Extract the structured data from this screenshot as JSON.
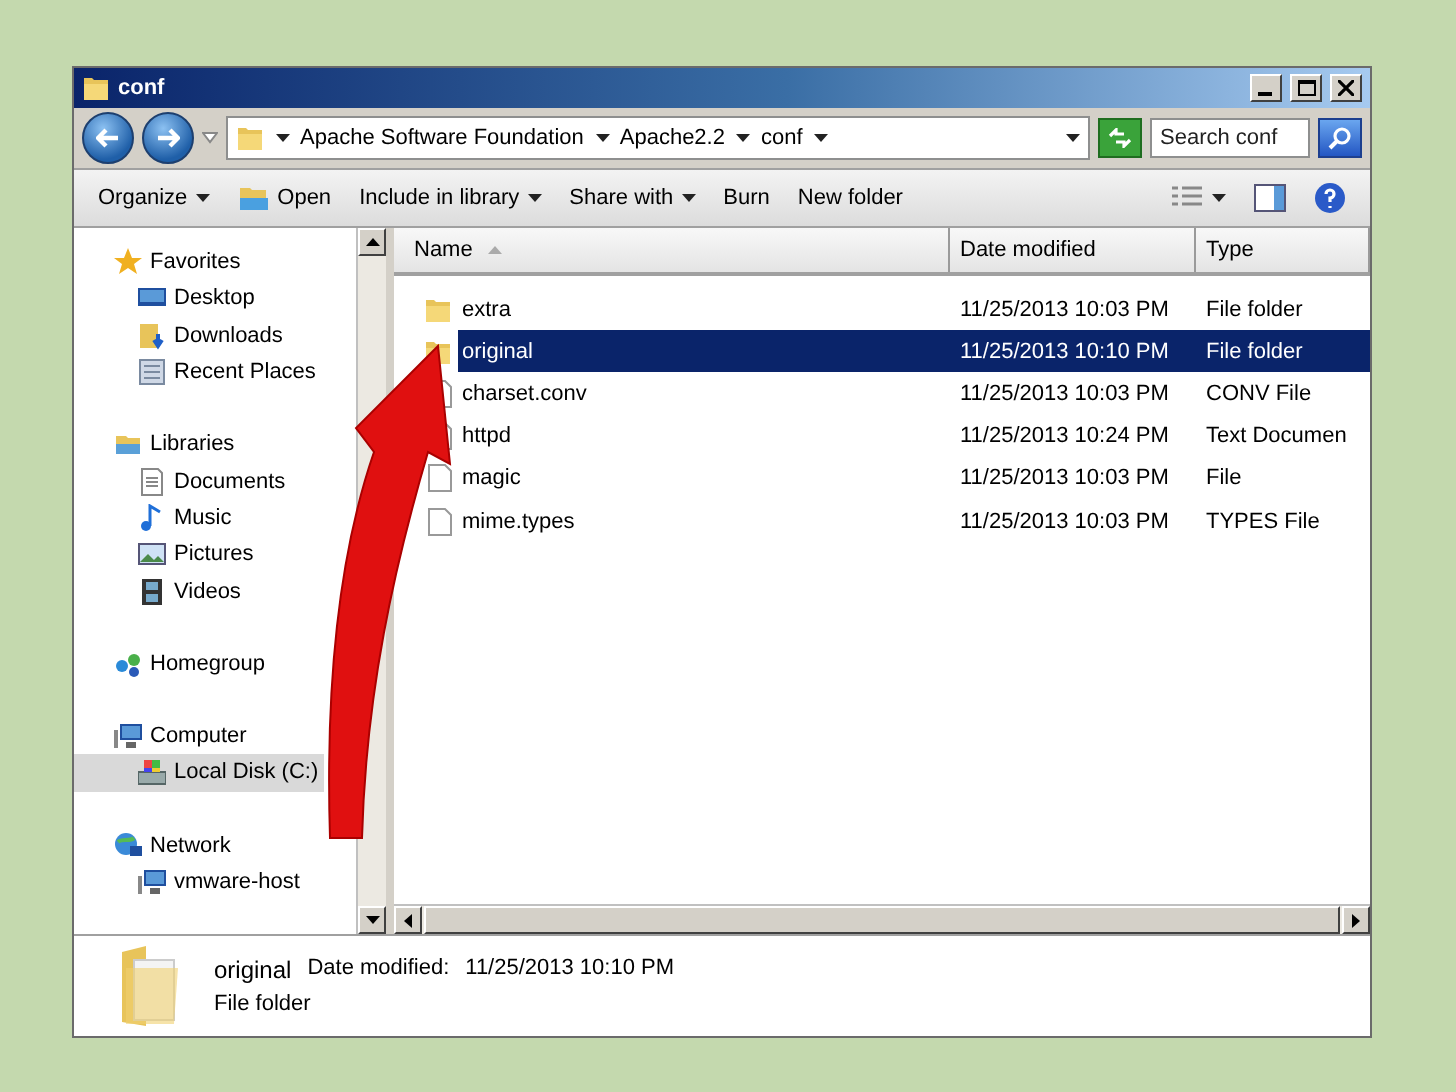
{
  "window": {
    "title": "conf"
  },
  "address": {
    "crumbs": [
      "Apache Software Foundation",
      "Apache2.2",
      "conf"
    ]
  },
  "search": {
    "placeholder": "Search conf"
  },
  "toolbar": [
    {
      "label": "Organize",
      "kind": "menu"
    },
    {
      "label": "Open",
      "kind": "open"
    },
    {
      "label": "Include in library",
      "kind": "menu"
    },
    {
      "label": "Share with",
      "kind": "menu"
    },
    {
      "label": "Burn",
      "kind": "plain"
    },
    {
      "label": "New folder",
      "kind": "plain"
    }
  ],
  "sidebar": {
    "items": [
      {
        "label": "Favorites",
        "kind": "favorites",
        "selected": false,
        "children": [
          {
            "label": "Desktop",
            "kind": "desktop",
            "selected": false
          },
          {
            "label": "Downloads",
            "kind": "downloads",
            "selected": false
          },
          {
            "label": "Recent Places",
            "kind": "recent",
            "selected": false
          }
        ]
      },
      {
        "label": "Libraries",
        "kind": "libraries",
        "selected": false,
        "children": [
          {
            "label": "Documents",
            "kind": "documents",
            "selected": false
          },
          {
            "label": "Music",
            "kind": "music",
            "selected": false
          },
          {
            "label": "Pictures",
            "kind": "pictures",
            "selected": false
          },
          {
            "label": "Videos",
            "kind": "videos",
            "selected": false
          }
        ]
      },
      {
        "label": "Homegroup",
        "kind": "homegroup",
        "selected": false
      },
      {
        "label": "Computer",
        "kind": "computer",
        "selected": false,
        "children": [
          {
            "label": "Local Disk (C:)",
            "kind": "disk",
            "selected": true
          }
        ]
      },
      {
        "label": "Network",
        "kind": "network",
        "selected": false,
        "children": [
          {
            "label": "vmware-host",
            "kind": "computer",
            "selected": false
          }
        ]
      }
    ]
  },
  "table": {
    "columns": [
      "Name",
      "Date modified",
      "Type"
    ],
    "rows": [
      {
        "name": "extra",
        "date": "11/25/2013 10:03 PM",
        "type": "File folder",
        "kind": "folder",
        "selected": false
      },
      {
        "name": "original",
        "date": "11/25/2013 10:10 PM",
        "type": "File folder",
        "kind": "folder",
        "selected": true
      },
      {
        "name": "charset.conv",
        "date": "11/25/2013 10:03 PM",
        "type": "CONV File",
        "kind": "file",
        "selected": false
      },
      {
        "name": "httpd",
        "date": "11/25/2013 10:24 PM",
        "type": "Text Documen",
        "kind": "text",
        "selected": false
      },
      {
        "name": "magic",
        "date": "11/25/2013 10:03 PM",
        "type": "File",
        "kind": "file",
        "selected": false
      },
      {
        "name": "mime.types",
        "date": "11/25/2013 10:03 PM",
        "type": "TYPES File",
        "kind": "file",
        "selected": false
      }
    ]
  },
  "details": {
    "name": "original",
    "date_label": "Date modified:",
    "date": "11/25/2013 10:10 PM",
    "type": "File folder"
  }
}
